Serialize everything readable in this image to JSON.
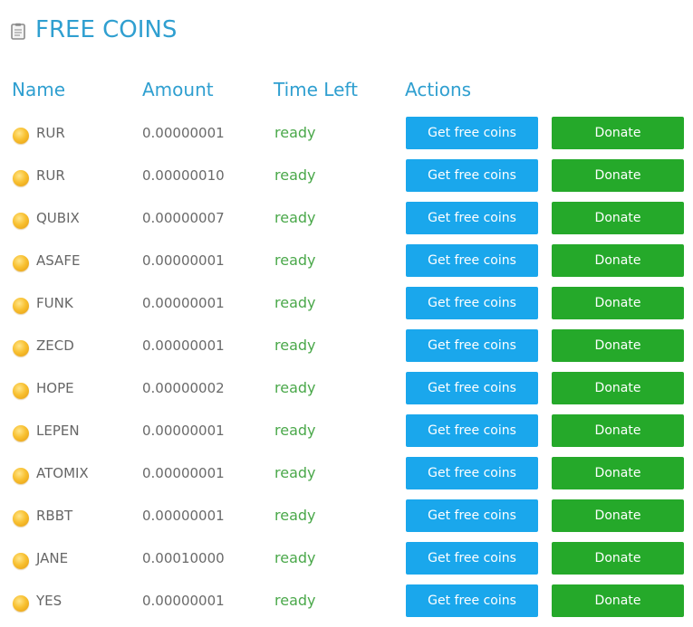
{
  "page": {
    "title": "FREE COINS",
    "title_icon": "clipboard-icon"
  },
  "table": {
    "headers": {
      "name": "Name",
      "amount": "Amount",
      "time_left": "Time Left",
      "actions": "Actions"
    },
    "rows": [
      {
        "name": "RUR",
        "amount": "0.00000001",
        "time_left": "ready",
        "get_label": "Get free coins",
        "donate_label": "Donate"
      },
      {
        "name": "RUR",
        "amount": "0.00000010",
        "time_left": "ready",
        "get_label": "Get free coins",
        "donate_label": "Donate"
      },
      {
        "name": "QUBIX",
        "amount": "0.00000007",
        "time_left": "ready",
        "get_label": "Get free coins",
        "donate_label": "Donate"
      },
      {
        "name": "ASAFE",
        "amount": "0.00000001",
        "time_left": "ready",
        "get_label": "Get free coins",
        "donate_label": "Donate"
      },
      {
        "name": "FUNK",
        "amount": "0.00000001",
        "time_left": "ready",
        "get_label": "Get free coins",
        "donate_label": "Donate"
      },
      {
        "name": "ZECD",
        "amount": "0.00000001",
        "time_left": "ready",
        "get_label": "Get free coins",
        "donate_label": "Donate"
      },
      {
        "name": "HOPE",
        "amount": "0.00000002",
        "time_left": "ready",
        "get_label": "Get free coins",
        "donate_label": "Donate"
      },
      {
        "name": "LEPEN",
        "amount": "0.00000001",
        "time_left": "ready",
        "get_label": "Get free coins",
        "donate_label": "Donate"
      },
      {
        "name": "ATOMIX",
        "amount": "0.00000001",
        "time_left": "ready",
        "get_label": "Get free coins",
        "donate_label": "Donate"
      },
      {
        "name": "RBBT",
        "amount": "0.00000001",
        "time_left": "ready",
        "get_label": "Get free coins",
        "donate_label": "Donate"
      },
      {
        "name": "JANE",
        "amount": "0.00010000",
        "time_left": "ready",
        "get_label": "Get free coins",
        "donate_label": "Donate"
      },
      {
        "name": "YES",
        "amount": "0.00000001",
        "time_left": "ready",
        "get_label": "Get free coins",
        "donate_label": "Donate"
      }
    ]
  },
  "colors": {
    "accent": "#2f9fd0",
    "get_button": "#1aa7ec",
    "donate_button": "#25a92a",
    "ready_status": "#4aa84a"
  }
}
